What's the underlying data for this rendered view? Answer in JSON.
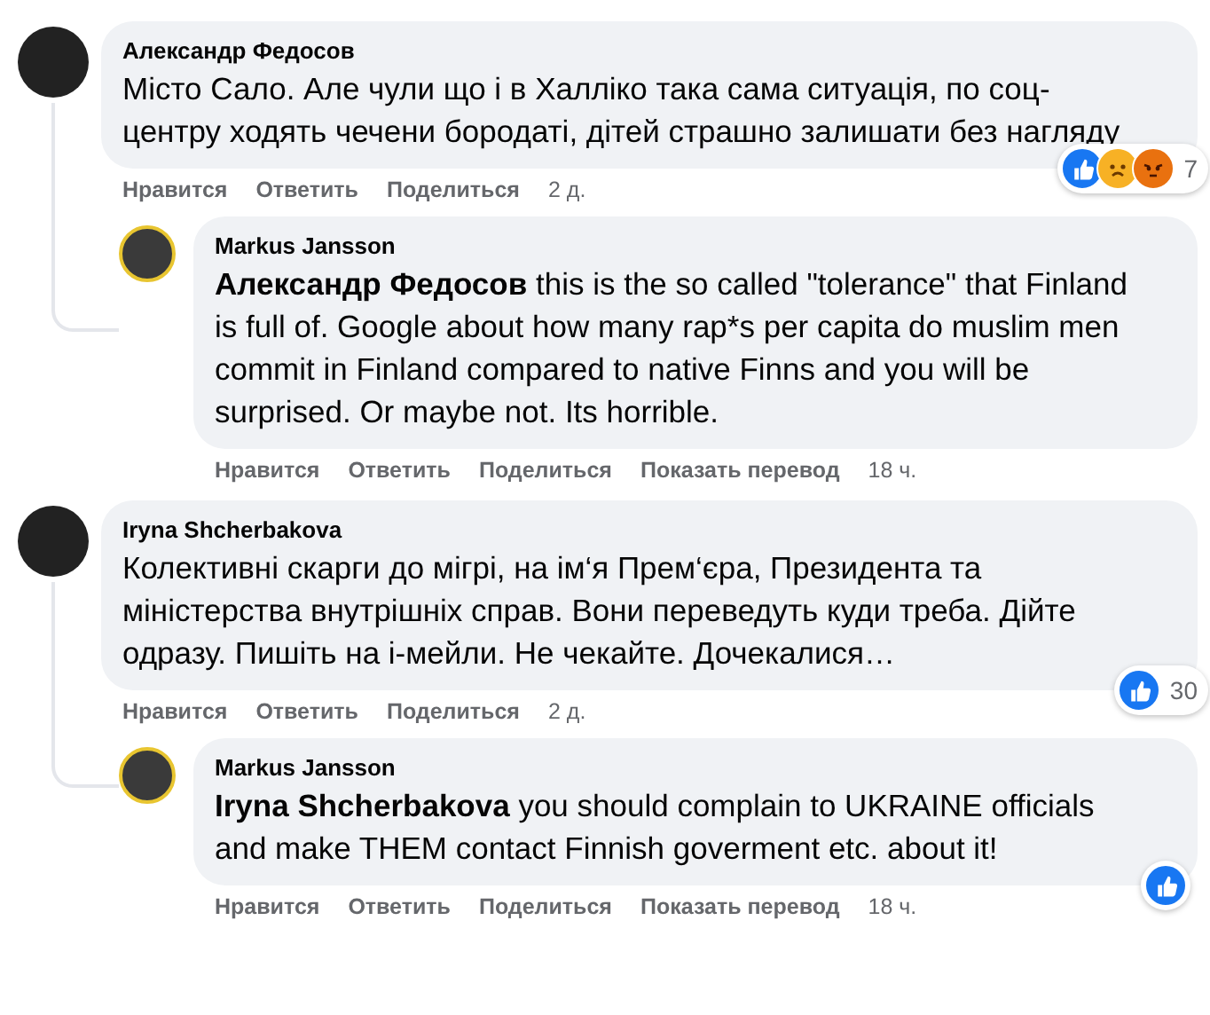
{
  "comments": [
    {
      "author": "Александр Федосов",
      "text": "Місто Сало. Але чули що і в Халліко така сама ситуація, по соц-центру ходять чечени бородаті, дітей страшно залишати без нагляду",
      "actions": [
        "Нравится",
        "Ответить",
        "Поделиться"
      ],
      "time": "2 д.",
      "reactions": {
        "icons": [
          {
            "kind": "like"
          },
          {
            "kind": "sad"
          },
          {
            "kind": "angry"
          }
        ],
        "count": "7"
      },
      "replies": [
        {
          "author": "Markus Jansson",
          "text": "**Александр Федосов** this is the so called \"tolerance\" that Finland is full of. Google about how many rap*s per capita do muslim men commit in Finland compared to native Finns and you will be surprised. Or maybe not. Its horrible.",
          "actions": [
            "Нравится",
            "Ответить",
            "Поделиться",
            "Показать перевод"
          ],
          "time": "18 ч."
        }
      ]
    },
    {
      "author": "Iryna Shcherbakova",
      "text": "Колективні скарги до мігрі, на ім‘я Прем‘єра, Президента та міністерства внутрішніх справ. Вони переведуть куди треба. Дійте одразу. Пишіть на і-мейли. Не чекайте. Дочекалися…",
      "actions": [
        "Нравится",
        "Ответить",
        "Поделиться"
      ],
      "time": "2 д.",
      "reactions": {
        "icons": [
          {
            "kind": "like"
          }
        ],
        "count": "30"
      },
      "replies": [
        {
          "author": "Markus Jansson",
          "text": "**Iryna Shcherbakova** you should complain to UKRAINE officials and make THEM contact Finnish goverment etc. about it!",
          "actions": [
            "Нравится",
            "Ответить",
            "Поделиться",
            "Показать перевод"
          ],
          "time": "18 ч.",
          "reactions": {
            "icons": [
              {
                "kind": "like"
              }
            ]
          }
        }
      ]
    }
  ]
}
